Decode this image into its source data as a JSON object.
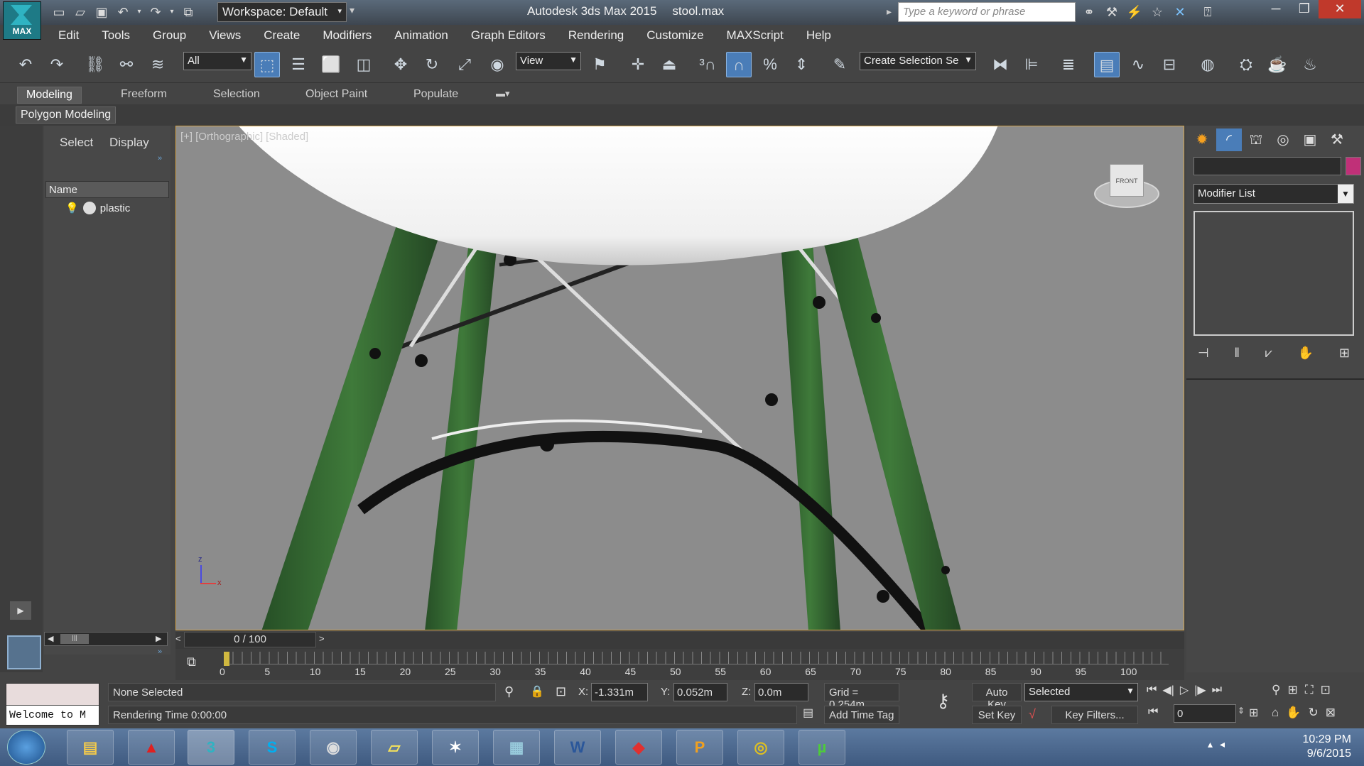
{
  "titlebar": {
    "logo_text": "MAX",
    "workspace": "Workspace: Default",
    "app_title": "Autodesk 3ds Max 2015",
    "file_name": "stool.max",
    "search_placeholder": "Type a keyword or phrase"
  },
  "menu": [
    "Edit",
    "Tools",
    "Group",
    "Views",
    "Create",
    "Modifiers",
    "Animation",
    "Graph Editors",
    "Rendering",
    "Customize",
    "MAXScript",
    "Help"
  ],
  "toolbar": {
    "filter": "All",
    "ref_coord": "View",
    "selection_set": "Create Selection Se"
  },
  "ribbon": {
    "tabs": [
      "Modeling",
      "Freeform",
      "Selection",
      "Object Paint",
      "Populate"
    ],
    "panel": "Polygon Modeling"
  },
  "explorer": {
    "tabs": [
      "Select",
      "Display"
    ],
    "column_header": "Name",
    "items": [
      {
        "name": "plastic"
      }
    ]
  },
  "viewport": {
    "label_parts": [
      "[+]",
      "[Orthographic]",
      "[Shaded]"
    ],
    "viewcube_label": "FRONT",
    "axis_labels": {
      "x": "x",
      "y": "y",
      "z": "z"
    }
  },
  "timeline": {
    "frame_display": "0 / 100",
    "ticks": [
      0,
      5,
      10,
      15,
      20,
      25,
      30,
      35,
      40,
      45,
      50,
      55,
      60,
      65,
      70,
      75,
      80,
      85,
      90,
      95,
      100
    ]
  },
  "command_panel": {
    "modifier_list": "Modifier List",
    "color": "#c03078"
  },
  "status": {
    "listener_text": "Welcome to M",
    "selection": "None Selected",
    "rendering_time": "Rendering Time  0:00:00",
    "x_label": "X:",
    "x_value": "-1.331m",
    "y_label": "Y:",
    "y_value": "0.052m",
    "z_label": "Z:",
    "z_value": "0.0m",
    "grid": "Grid = 0.254m",
    "add_time_tag": "Add Time Tag",
    "auto_key": "Auto Key",
    "set_key": "Set Key",
    "key_mode": "Selected",
    "key_filters": "Key Filters...",
    "current_frame": "0"
  },
  "taskbar": {
    "time": "10:29 PM",
    "date": "9/6/2015"
  }
}
